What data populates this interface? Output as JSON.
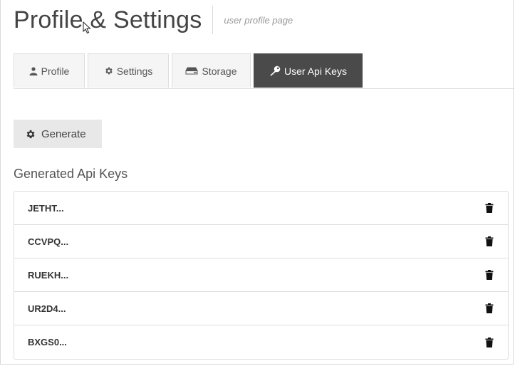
{
  "header": {
    "title": "Profile & Settings",
    "subtitle": "user profile page"
  },
  "tabs": [
    {
      "label": "Profile",
      "icon": "user-icon",
      "active": false
    },
    {
      "label": "Settings",
      "icon": "gear-icon",
      "active": false
    },
    {
      "label": "Storage",
      "icon": "hdd-icon",
      "active": false
    },
    {
      "label": "User Api Keys",
      "icon": "key-icon",
      "active": true
    }
  ],
  "generate_button": {
    "label": "Generate",
    "icon": "gear-icon"
  },
  "keys_section": {
    "title": "Generated Api Keys",
    "keys": [
      {
        "value": "JETHT...",
        "action_icon": "trash-icon"
      },
      {
        "value": "CCVPQ...",
        "action_icon": "trash-icon"
      },
      {
        "value": "RUEKH...",
        "action_icon": "trash-icon"
      },
      {
        "value": "UR2D4...",
        "action_icon": "trash-icon"
      },
      {
        "value": "BXGS0...",
        "action_icon": "trash-icon"
      }
    ]
  },
  "colors": {
    "active_tab_bg": "#4a4a4a",
    "tab_bg": "#f5f5f5",
    "button_bg": "#e8e8e8"
  }
}
